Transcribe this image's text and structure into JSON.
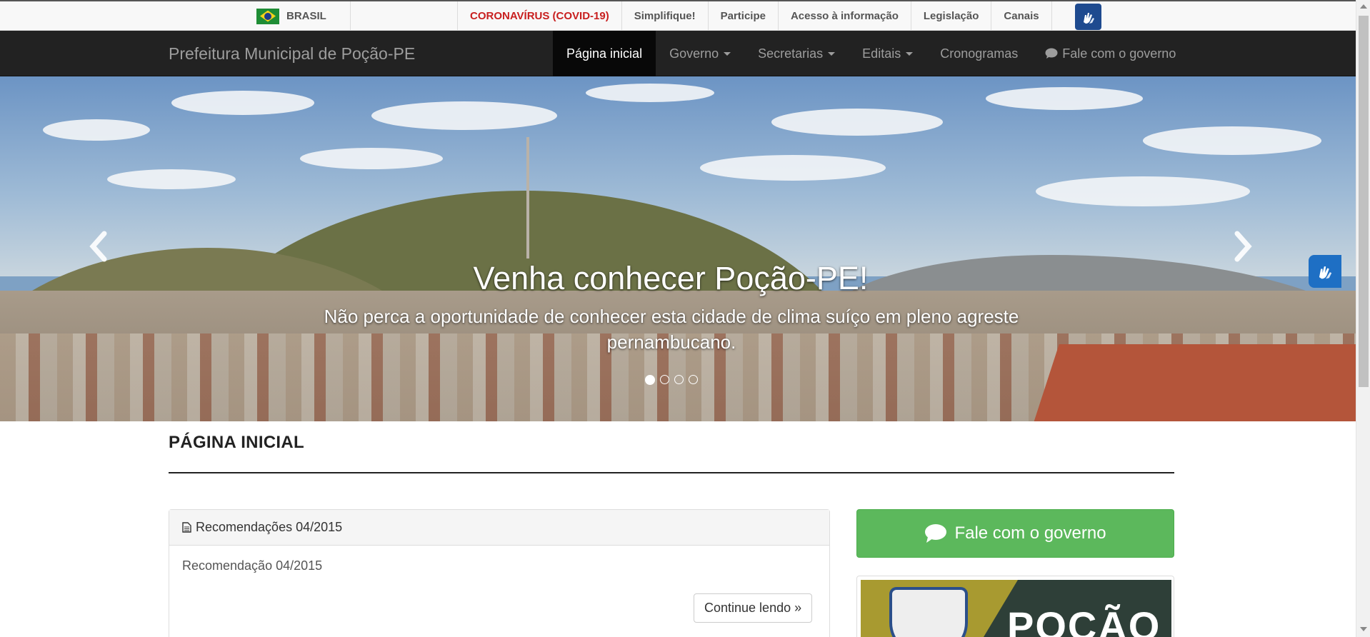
{
  "govbar": {
    "country": "BRASIL",
    "links": [
      {
        "label": "CORONAVÍRUS (COVID-19)",
        "highlight": true
      },
      {
        "label": "Simplifique!"
      },
      {
        "label": "Participe"
      },
      {
        "label": "Acesso à informação"
      },
      {
        "label": "Legislação"
      },
      {
        "label": "Canais"
      }
    ],
    "accessibility_icon": "hands-sign-language-icon"
  },
  "navbar": {
    "brand": "Prefeitura Municipal de Poção-PE",
    "items": [
      {
        "label": "Página inicial",
        "active": true
      },
      {
        "label": "Governo",
        "dropdown": true
      },
      {
        "label": "Secretarias",
        "dropdown": true
      },
      {
        "label": "Editais",
        "dropdown": true
      },
      {
        "label": "Cronogramas"
      },
      {
        "label": "Fale com o governo",
        "icon": "comment-icon"
      }
    ]
  },
  "carousel": {
    "title": "Venha conhecer Poção-PE!",
    "text": "Não perca a oportunidade de conhecer esta cidade de clima suíço em pleno agreste pernambucano.",
    "slides": 4,
    "active_slide": 1
  },
  "page": {
    "heading": "PÁGINA INICIAL"
  },
  "post": {
    "title": "Recomendações 04/2015",
    "body": "Recomendação 04/2015",
    "more_label": "Continue lendo »"
  },
  "sidebar": {
    "contact_button": "Fale com o governo",
    "banner_text": "POÇÃO"
  },
  "colors": {
    "navbar_bg": "#222222",
    "covid_red": "#c81e1e",
    "success_green": "#5cb85c",
    "vlibras_blue": "#1e4a8f"
  }
}
